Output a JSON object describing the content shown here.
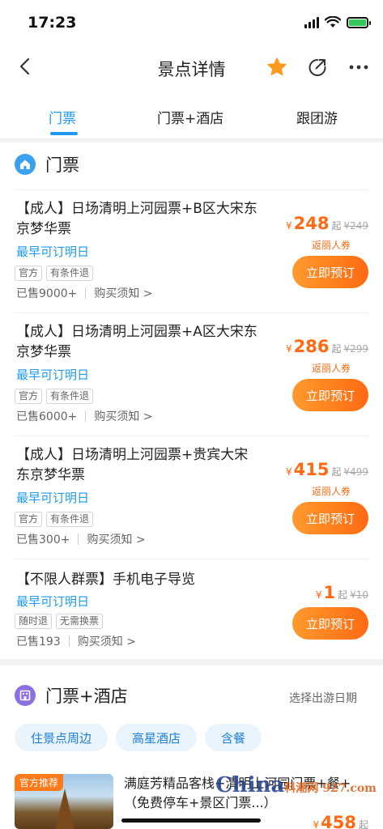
{
  "status": {
    "time": "17:23"
  },
  "nav": {
    "title": "景点详情"
  },
  "tabs": [
    {
      "label": "门票"
    },
    {
      "label": "门票+酒店"
    },
    {
      "label": "跟团游"
    }
  ],
  "tickets_section": {
    "title": "门票",
    "items": [
      {
        "name": "【成人】日场清明上河园票+B区大宋东京梦华票",
        "date": "最早可订明日",
        "tags": [
          "官方",
          "有条件退"
        ],
        "sold": "已售9000+",
        "notice": "购买须知 >",
        "currency": "¥",
        "price": "248",
        "qi": "起",
        "orig": "¥249",
        "refund": "返丽人券",
        "book": "立即预订"
      },
      {
        "name": "【成人】日场清明上河园票+A区大宋东京梦华票",
        "date": "最早可订明日",
        "tags": [
          "官方",
          "有条件退"
        ],
        "sold": "已售6000+",
        "notice": "购买须知 >",
        "currency": "¥",
        "price": "286",
        "qi": "起",
        "orig": "¥299",
        "refund": "返丽人券",
        "book": "立即预订"
      },
      {
        "name": "【成人】日场清明上河园票+贵宾大宋东京梦华票",
        "date": "最早可订明日",
        "tags": [
          "官方",
          "有条件退"
        ],
        "sold": "已售300+",
        "notice": "购买须知 >",
        "currency": "¥",
        "price": "415",
        "qi": "起",
        "orig": "¥499",
        "refund": "返丽人券",
        "book": "立即预订"
      },
      {
        "name": "【不限人群票】手机电子导览",
        "date": "最早可订明日",
        "tags": [
          "随时退",
          "无需换票"
        ],
        "sold": "已售193",
        "notice": "购买须知 >",
        "currency": "¥",
        "price": "1",
        "qi": "起",
        "orig": "¥10",
        "book": "立即预订"
      }
    ]
  },
  "hotel_section": {
    "title": "门票+酒店",
    "right_link": "选择出游日期",
    "chips": [
      "住景点周边",
      "高星酒店",
      "含餐"
    ],
    "item": {
      "badge": "官方推荐",
      "name": "满庭芳精品客栈+清明上河园门票+餐+（免费停车+景区门票...）",
      "currency": "¥",
      "price": "458",
      "qi": "起"
    }
  },
  "watermark": {
    "text": "China",
    "sub": "科潮网 927.com"
  },
  "colors": {
    "accent": "#1e9bf0",
    "price": "#ff6a12",
    "star": "#ff9a1f"
  }
}
